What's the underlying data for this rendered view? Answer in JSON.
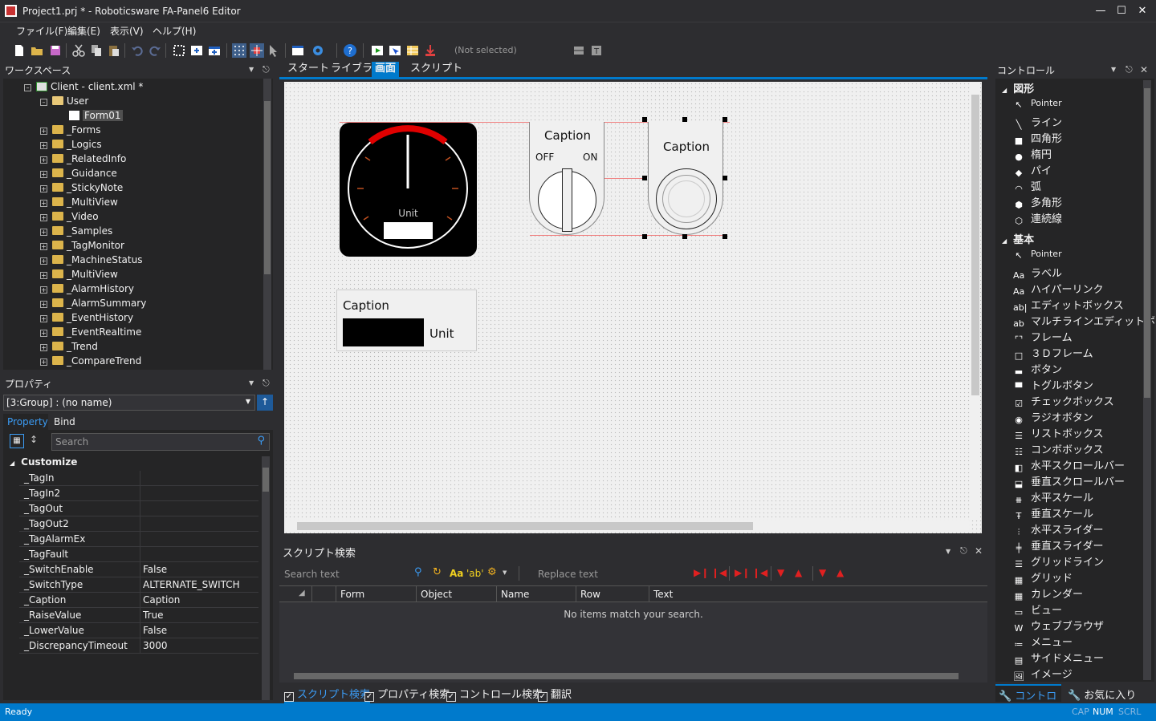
{
  "window": {
    "title": "Project1.prj * - Roboticsware FA-Panel6 Editor"
  },
  "menu": [
    "ファイル(F)",
    "編集(E)",
    "表示(V)",
    "ヘルプ(H)"
  ],
  "toolbar": {
    "selection_text": "(Not selected)"
  },
  "workspace": {
    "title": "ワークスペース",
    "root": "Client - client.xml *",
    "user": "User",
    "selected_form": "Form01",
    "folders": [
      "_Forms",
      "_Logics",
      "_RelatedInfo",
      "_Guidance",
      "_StickyNote",
      "_MultiView",
      "_Video",
      "_Samples",
      "_TagMonitor",
      "_MachineStatus",
      "_MultiView",
      "_AlarmHistory",
      "_AlarmSummary",
      "_EventHistory",
      "_EventRealtime",
      "_Trend",
      "_CompareTrend"
    ]
  },
  "properties": {
    "title": "プロパティ",
    "selector": "[3:Group] : (no name)",
    "tabs": [
      "Property",
      "Bind"
    ],
    "search_placeholder": "Search",
    "category": "Customize",
    "rows": [
      {
        "name": "_TagIn",
        "value": ""
      },
      {
        "name": "_TagIn2",
        "value": ""
      },
      {
        "name": "_TagOut",
        "value": ""
      },
      {
        "name": "_TagOut2",
        "value": ""
      },
      {
        "name": "_TagAlarmEx",
        "value": ""
      },
      {
        "name": "_TagFault",
        "value": ""
      },
      {
        "name": "_SwitchEnable",
        "value": "False"
      },
      {
        "name": "_SwitchType",
        "value": "ALTERNATE_SWITCH"
      },
      {
        "name": "_Caption",
        "value": "Caption"
      },
      {
        "name": "_RaiseValue",
        "value": "True"
      },
      {
        "name": "_LowerValue",
        "value": "False"
      },
      {
        "name": "_DiscrepancyTimeout",
        "value": "3000"
      }
    ]
  },
  "designer": {
    "tabs": [
      "スタート",
      "ライブラリ",
      "画面",
      "スクリプト"
    ],
    "active_tab": "画面",
    "gauge_unit": "Unit",
    "switch_caption": "Caption",
    "switch_off": "OFF",
    "switch_on": "ON",
    "button_caption": "Caption",
    "display_caption": "Caption",
    "display_unit": "Unit"
  },
  "script_search": {
    "title": "スクリプト検索",
    "search_placeholder": "Search text",
    "replace_placeholder": "Replace text",
    "case_label": "Aa",
    "word_label": "'ab'",
    "columns": [
      "Form",
      "Object",
      "Name",
      "Row",
      "Text"
    ],
    "empty_message": "No items match your search."
  },
  "bottom_tabs": [
    "スクリプト検索",
    "プロパティ検索",
    "コントロール検索",
    "翻訳"
  ],
  "controls": {
    "title": "コントロール",
    "sections": [
      {
        "name": "図形",
        "items": [
          {
            "icon": "pointer-icon",
            "label": "Pointer"
          },
          {
            "icon": "line-icon",
            "label": "ライン"
          },
          {
            "icon": "square-icon",
            "label": "四角形"
          },
          {
            "icon": "ellipse-icon",
            "label": "楕円"
          },
          {
            "icon": "pie-icon",
            "label": "パイ"
          },
          {
            "icon": "arc-icon",
            "label": "弧"
          },
          {
            "icon": "polygon-icon",
            "label": "多角形"
          },
          {
            "icon": "polyline-icon",
            "label": "連続線"
          }
        ]
      },
      {
        "name": "基本",
        "items": [
          {
            "icon": "pointer-icon",
            "label": "Pointer"
          },
          {
            "icon": "label-icon",
            "label": "ラベル"
          },
          {
            "icon": "hyperlink-icon",
            "label": "ハイパーリンク"
          },
          {
            "icon": "editbox-icon",
            "label": "エディットボックス"
          },
          {
            "icon": "multiline-editbox-icon",
            "label": "マルチラインエディットボッ..."
          },
          {
            "icon": "frame-icon",
            "label": "フレーム"
          },
          {
            "icon": "3d-frame-icon",
            "label": "３Ｄフレーム"
          },
          {
            "icon": "button-icon",
            "label": "ボタン"
          },
          {
            "icon": "toggle-button-icon",
            "label": "トグルボタン"
          },
          {
            "icon": "checkbox-icon",
            "label": "チェックボックス"
          },
          {
            "icon": "radio-button-icon",
            "label": "ラジオボタン"
          },
          {
            "icon": "listbox-icon",
            "label": "リストボックス"
          },
          {
            "icon": "combobox-icon",
            "label": "コンボボックス"
          },
          {
            "icon": "hscrollbar-icon",
            "label": "水平スクロールバー"
          },
          {
            "icon": "vscrollbar-icon",
            "label": "垂直スクロールバー"
          },
          {
            "icon": "hscale-icon",
            "label": "水平スケール"
          },
          {
            "icon": "vscale-icon",
            "label": "垂直スケール"
          },
          {
            "icon": "hslider-icon",
            "label": "水平スライダー"
          },
          {
            "icon": "vslider-icon",
            "label": "垂直スライダー"
          },
          {
            "icon": "gridline-icon",
            "label": "グリッドライン"
          },
          {
            "icon": "grid-icon",
            "label": "グリッド"
          },
          {
            "icon": "calendar-icon",
            "label": "カレンダー"
          },
          {
            "icon": "view-icon",
            "label": "ビュー"
          },
          {
            "icon": "web-browser-icon",
            "label": "ウェブブラウザ"
          },
          {
            "icon": "menu-icon",
            "label": "メニュー"
          },
          {
            "icon": "side-menu-icon",
            "label": "サイドメニュー"
          },
          {
            "icon": "image-icon",
            "label": "イメージ"
          }
        ]
      }
    ],
    "bottom_tabs": [
      "コントロール",
      "お気に入り"
    ]
  },
  "statusbar": {
    "status": "Ready",
    "cap": "CAP",
    "num": "NUM",
    "scrl": "SCRL"
  },
  "colors": {
    "accent": "#007acc",
    "background": "#2d2d30",
    "canvas": "#f0f0f0",
    "gauge_red": "#e00000"
  }
}
